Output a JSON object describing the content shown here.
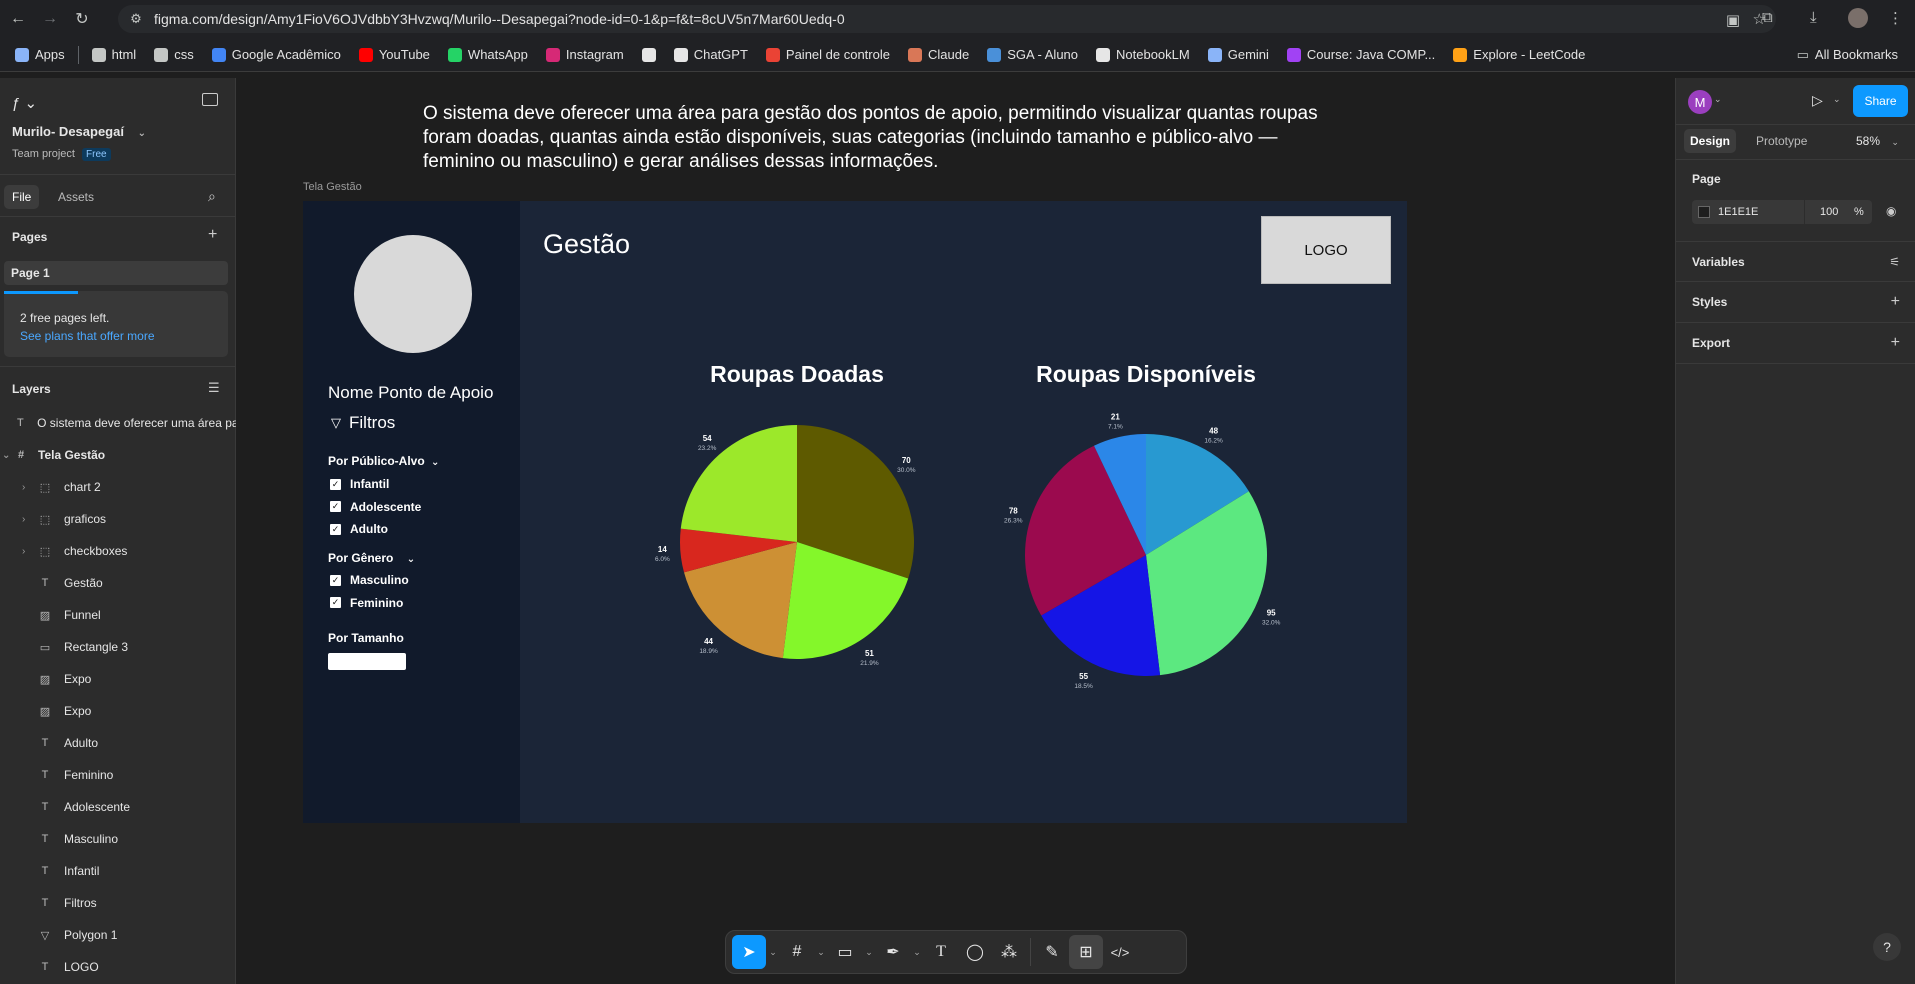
{
  "browser": {
    "url": "figma.com/design/Amy1FioV6OJVdbbY3Hvzwq/Murilo--Desapegai?node-id=0-1&p=f&t=8cUV5n7Mar60Uedq-0",
    "bookmarks": [
      {
        "label": "Apps",
        "icon": "apps-grid-icon",
        "color": "#8ab4f8"
      },
      {
        "label": "html",
        "icon": "folder-icon",
        "color": "#c4c7c5"
      },
      {
        "label": "css",
        "icon": "folder-icon",
        "color": "#c4c7c5"
      },
      {
        "label": "Google Acadêmico",
        "icon": "scholar-icon",
        "color": "#4285f4"
      },
      {
        "label": "YouTube",
        "icon": "youtube-icon",
        "color": "#ff0000"
      },
      {
        "label": "WhatsApp",
        "icon": "whatsapp-icon",
        "color": "#25d366"
      },
      {
        "label": "Instagram",
        "icon": "instagram-icon",
        "color": "#d62976"
      },
      {
        "label": "",
        "icon": "app-icon",
        "color": "#e6e6e6"
      },
      {
        "label": "ChatGPT",
        "icon": "chatgpt-icon",
        "color": "#e6e6e6"
      },
      {
        "label": "Painel de controle",
        "icon": "panel-icon",
        "color": "#ea4335"
      },
      {
        "label": "Claude",
        "icon": "claude-icon",
        "color": "#d97757"
      },
      {
        "label": "SGA - Aluno",
        "icon": "sga-icon",
        "color": "#4a90d9"
      },
      {
        "label": "NotebookLM",
        "icon": "notebooklm-icon",
        "color": "#e6e6e6"
      },
      {
        "label": "Gemini",
        "icon": "gemini-icon",
        "color": "#8ab4f8"
      },
      {
        "label": "Course: Java COMP...",
        "icon": "course-icon",
        "color": "#a142f4"
      },
      {
        "label": "Explore - LeetCode",
        "icon": "leetcode-icon",
        "color": "#ffa116"
      }
    ],
    "all_bookmarks": "All Bookmarks"
  },
  "figma_left": {
    "project_name": "Murilo- Desapegaí",
    "team": "Team project",
    "plan_badge": "Free",
    "tab_file": "File",
    "tab_assets": "Assets",
    "pages_title": "Pages",
    "page_1": "Page 1",
    "free_pages_msg": "2 free pages left.",
    "see_plans": "See plans that offer more",
    "layers_title": "Layers",
    "layers": [
      {
        "name": "O sistema deve oferecer uma área par",
        "icon": "T",
        "chev": ""
      },
      {
        "name": "Tela Gestão",
        "icon": "#",
        "chev": "⌄"
      },
      {
        "name": "chart 2",
        "icon": "⬚",
        "chev": "›"
      },
      {
        "name": "graficos",
        "icon": "⬚",
        "chev": "›"
      },
      {
        "name": "checkboxes",
        "icon": "⬚",
        "chev": "›"
      },
      {
        "name": "Gestão",
        "icon": "T",
        "chev": ""
      },
      {
        "name": "Funnel",
        "icon": "▨",
        "chev": ""
      },
      {
        "name": "Rectangle 3",
        "icon": "▭",
        "chev": ""
      },
      {
        "name": "Expo",
        "icon": "▨",
        "chev": ""
      },
      {
        "name": "Expo",
        "icon": "▨",
        "chev": ""
      },
      {
        "name": "Adulto",
        "icon": "T",
        "chev": ""
      },
      {
        "name": "Feminino",
        "icon": "T",
        "chev": ""
      },
      {
        "name": "Adolescente",
        "icon": "T",
        "chev": ""
      },
      {
        "name": "Masculino",
        "icon": "T",
        "chev": ""
      },
      {
        "name": "Infantil",
        "icon": "T",
        "chev": ""
      },
      {
        "name": "Filtros",
        "icon": "T",
        "chev": ""
      },
      {
        "name": "Polygon 1",
        "icon": "▽",
        "chev": ""
      },
      {
        "name": "LOGO",
        "icon": "T",
        "chev": ""
      }
    ]
  },
  "canvas": {
    "description_text": "O sistema deve oferecer uma área para gestão dos pontos de apoio, permitindo visualizar quantas roupas foram doadas, quantas ainda estão disponíveis, suas categorias (incluindo tamanho e público-alvo — feminino ou masculino) e gerar análises dessas informações.",
    "frame_label": "Tela Gestão",
    "frame": {
      "title": "Gestão",
      "logo": "LOGO",
      "point_name": "Nome Ponto de Apoio",
      "filters_label": "Filtros",
      "audience_title": "Por Público-Alvo",
      "audience_options": [
        "Infantil",
        "Adolescente",
        "Adulto"
      ],
      "gender_title": "Por Gênero",
      "gender_options": [
        "Masculino",
        "Feminino"
      ],
      "size_title": "Por Tamanho"
    }
  },
  "chart_data": [
    {
      "type": "pie",
      "title": "Roupas Doadas",
      "slices": [
        {
          "value": 70,
          "pct": "30.0%",
          "color": "#5e5a00"
        },
        {
          "value": 51,
          "pct": "21.9%",
          "color": "#84f72a"
        },
        {
          "value": 44,
          "pct": "18.9%",
          "color": "#cd9034"
        },
        {
          "value": 14,
          "pct": "6.0%",
          "color": "#d8271e"
        },
        {
          "value": 54,
          "pct": "23.2%",
          "color": "#9ce82a"
        }
      ]
    },
    {
      "type": "pie",
      "title": "Roupas Disponíveis",
      "slices": [
        {
          "value": 48,
          "pct": "16.2%",
          "color": "#2899d1"
        },
        {
          "value": 95,
          "pct": "32.0%",
          "color": "#5ce880"
        },
        {
          "value": 55,
          "pct": "18.5%",
          "color": "#1515e6"
        },
        {
          "value": 78,
          "pct": "26.3%",
          "color": "#9b0a4e"
        },
        {
          "value": 21,
          "pct": "7.1%",
          "color": "#2b87e8"
        }
      ]
    }
  ],
  "figma_right": {
    "avatar_letter": "M",
    "share": "Share",
    "tab_design": "Design",
    "tab_prototype": "Prototype",
    "zoom": "58%",
    "page_title": "Page",
    "page_color": "1E1E1E",
    "page_opacity": "100",
    "percent": "%",
    "variables": "Variables",
    "styles": "Styles",
    "export": "Export",
    "help": "?"
  }
}
